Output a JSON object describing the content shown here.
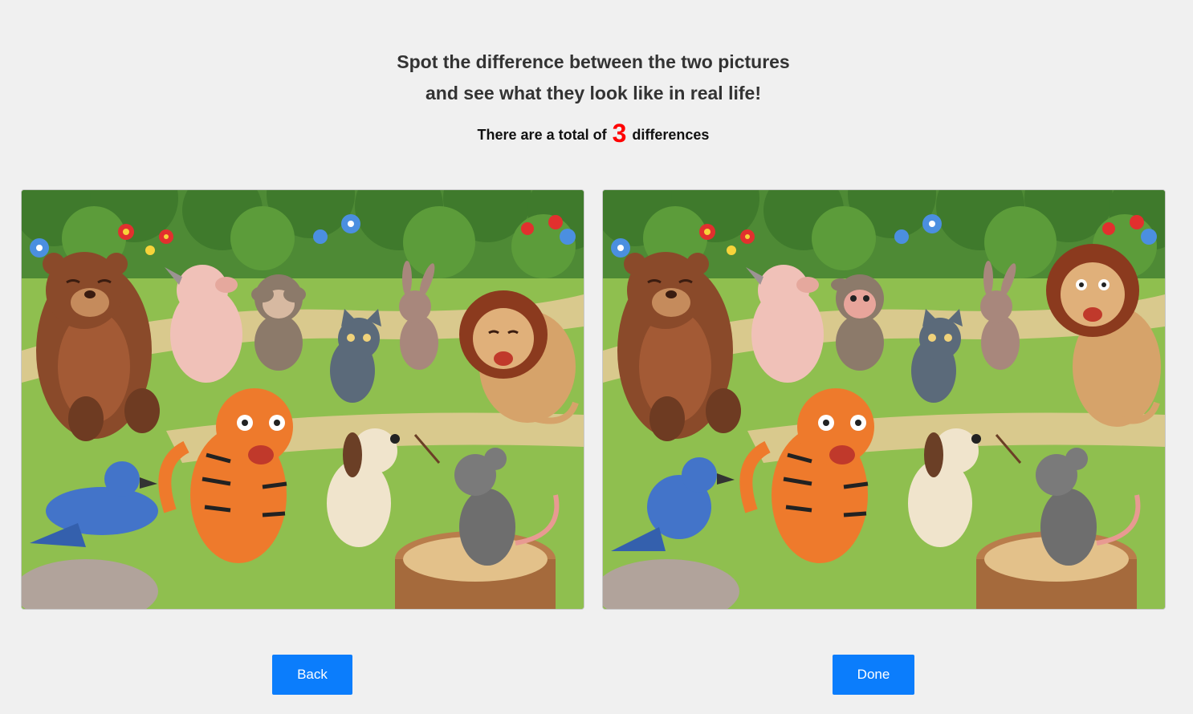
{
  "header": {
    "line1": "Spot the difference between the two pictures",
    "line2": "and see what they look like in real life!",
    "count_prefix": "There are a total of",
    "count_value": "3",
    "count_suffix": "differences"
  },
  "colors": {
    "background": "#f0f0f0",
    "button": "#0b7dfc",
    "count_highlight": "#ff0000"
  },
  "puzzle": {
    "scene": "forest-clearing-animal-choir",
    "animals": [
      "bear",
      "pig",
      "monkey",
      "cat",
      "rabbit",
      "lion",
      "tiger",
      "blue-bird",
      "dog",
      "mouse-conductor"
    ],
    "differences_total": 3
  },
  "buttons": {
    "back": "Back",
    "done": "Done"
  }
}
